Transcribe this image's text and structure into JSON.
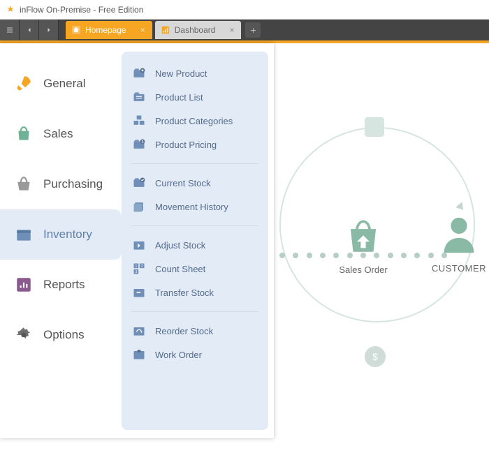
{
  "window": {
    "title": "inFlow On-Premise - Free Edition"
  },
  "tabs": {
    "items": [
      {
        "label": "Homepage",
        "active": true
      },
      {
        "label": "Dashboard",
        "active": false
      }
    ]
  },
  "nav": {
    "items": [
      {
        "label": "General"
      },
      {
        "label": "Sales"
      },
      {
        "label": "Purchasing"
      },
      {
        "label": "Inventory"
      },
      {
        "label": "Reports"
      },
      {
        "label": "Options"
      }
    ],
    "selected": "Inventory"
  },
  "submenu": {
    "groups": [
      [
        {
          "label": "New Product",
          "icon": "folder-plus"
        },
        {
          "label": "Product List",
          "icon": "folder-list"
        },
        {
          "label": "Product Categories",
          "icon": "boxes"
        },
        {
          "label": "Product Pricing",
          "icon": "folder-dollar"
        }
      ],
      [
        {
          "label": "Current Stock",
          "icon": "folder-check"
        },
        {
          "label": "Movement History",
          "icon": "history"
        }
      ],
      [
        {
          "label": "Adjust Stock",
          "icon": "adjust"
        },
        {
          "label": "Count Sheet",
          "icon": "count"
        },
        {
          "label": "Transfer Stock",
          "icon": "transfer"
        }
      ],
      [
        {
          "label": "Reorder Stock",
          "icon": "reorder"
        },
        {
          "label": "Work Order",
          "icon": "work"
        }
      ]
    ]
  },
  "diagram": {
    "sales_order": "Sales Order",
    "customer": "CUSTOMER"
  },
  "colors": {
    "accent": "#f6a623",
    "nav_selected_bg": "#e3ecf6",
    "nav_text": "#555",
    "sub_text": "#546a8c",
    "diagram_green": "#8ab9a6"
  }
}
